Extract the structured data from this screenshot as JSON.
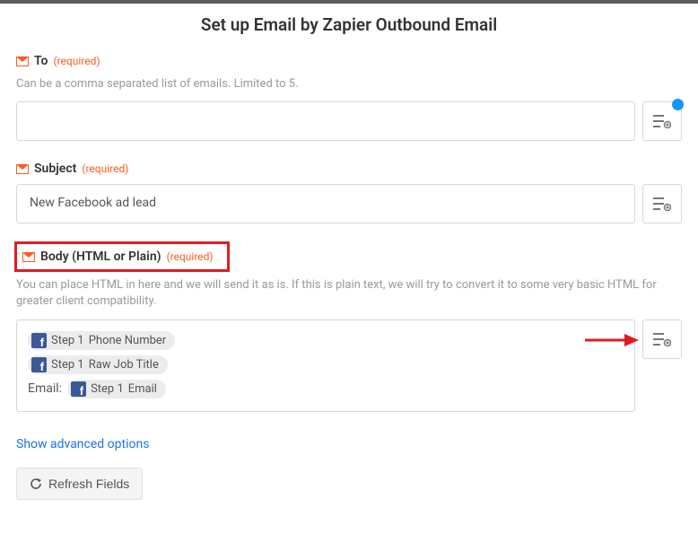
{
  "page_title": "Set up Email by Zapier Outbound Email",
  "fields": {
    "to": {
      "label": "To",
      "required": "(required)",
      "help": "Can be a comma separated list of emails. Limited to 5.",
      "value": ""
    },
    "subject": {
      "label": "Subject",
      "required": "(required)",
      "value": "New Facebook ad lead"
    },
    "body": {
      "label": "Body (HTML or Plain)",
      "required": "(required)",
      "help": "You can place HTML in here and we will send it as is. If this is plain text, we will try to convert it to some very basic HTML for greater client compatibility.",
      "pills": {
        "step_prefix": "Step 1",
        "phone": "Phone Number",
        "job": "Raw Job Title",
        "email": "Email"
      },
      "email_prefix": "Email:"
    }
  },
  "advanced_link": "Show advanced options",
  "refresh_button": "Refresh Fields"
}
